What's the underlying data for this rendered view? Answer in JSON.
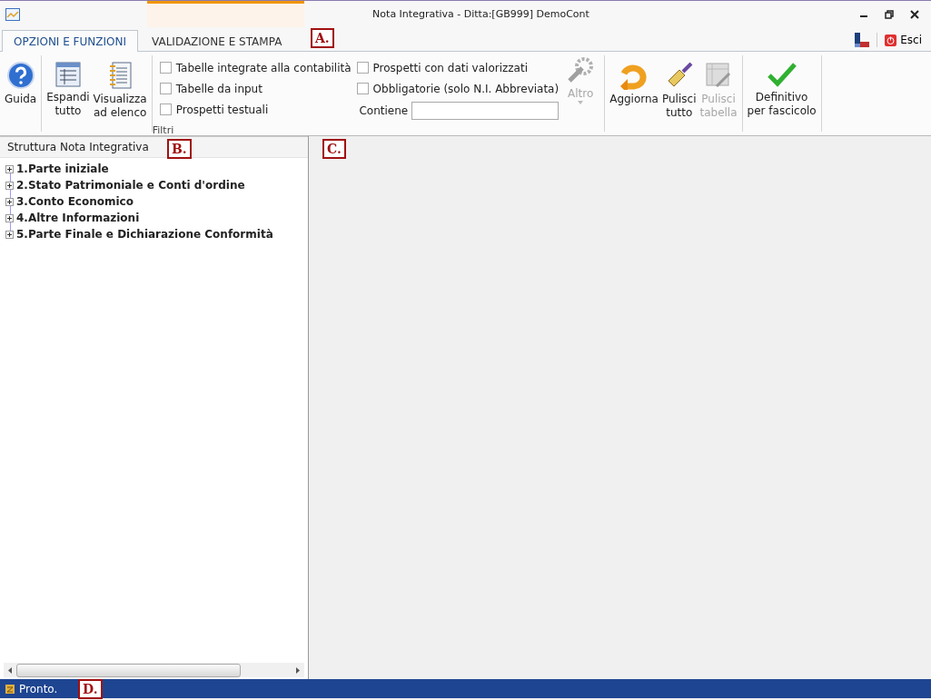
{
  "window": {
    "title": "Nota Integrativa - Ditta:[GB999] DemoCont"
  },
  "tabs": [
    {
      "label": "OPZIONI E FUNZIONI",
      "selected": true
    },
    {
      "label": "VALIDAZIONE E STAMPA",
      "selected": false
    }
  ],
  "exit_button": {
    "label": "Esci"
  },
  "ribbon": {
    "groups": [
      {
        "kind": "buttons",
        "buttons": [
          {
            "label": "Guida",
            "disabled": false
          }
        ]
      },
      {
        "kind": "buttons",
        "buttons": [
          {
            "label": "Espandi\ntutto",
            "disabled": false
          },
          {
            "label": "Visualizza\nad elenco",
            "disabled": false
          }
        ]
      },
      {
        "kind": "filters",
        "title": "Filtri",
        "checkboxes": [
          {
            "label": "Tabelle integrate alla contabilità",
            "checked": false
          },
          {
            "label": "Tabelle da input",
            "checked": false
          },
          {
            "label": "Prospetti testuali",
            "checked": false
          },
          {
            "label": "Prospetti con dati valorizzati",
            "checked": false
          },
          {
            "label": "Obbligatorie (solo N.I. Abbreviata)",
            "checked": false
          }
        ],
        "search_label": "Contiene",
        "altro": {
          "label": "Altro",
          "disabled": true
        }
      },
      {
        "kind": "buttons",
        "buttons": [
          {
            "label": "Aggiorna",
            "disabled": false
          },
          {
            "label": "Pulisci\ntutto",
            "disabled": false
          },
          {
            "label": "Pulisci\ntabella",
            "disabled": true
          }
        ]
      },
      {
        "kind": "buttons",
        "buttons": [
          {
            "label": "Definitivo\nper fascicolo",
            "disabled": false
          }
        ]
      }
    ]
  },
  "tree": {
    "title": "Struttura Nota Integrativa",
    "items": [
      {
        "label": "1.Parte iniziale",
        "expanded": false
      },
      {
        "label": "2.Stato Patrimoniale e Conti d'ordine",
        "expanded": false
      },
      {
        "label": "3.Conto Economico",
        "expanded": false
      },
      {
        "label": "4.Altre Informazioni",
        "expanded": false
      },
      {
        "label": "5.Parte Finale e Dichiarazione Conformità",
        "expanded": false
      }
    ]
  },
  "status_bar": {
    "text": "Pronto."
  },
  "callouts": [
    {
      "label": "A."
    },
    {
      "label": "B."
    },
    {
      "label": "C."
    },
    {
      "label": "D."
    }
  ]
}
